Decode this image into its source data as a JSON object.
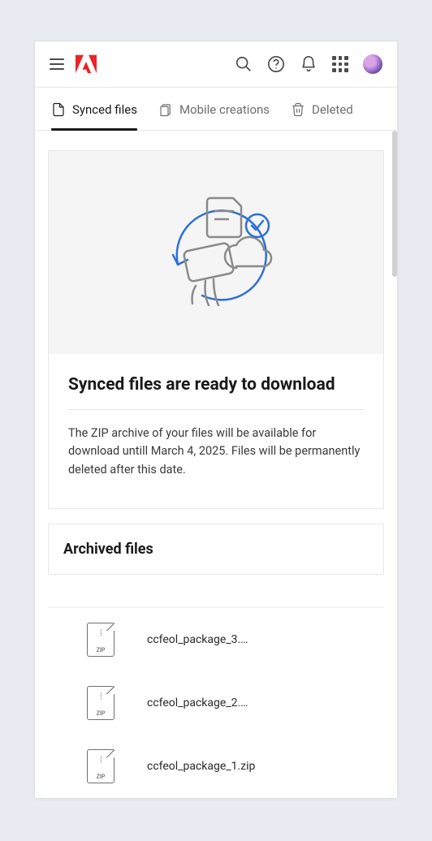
{
  "tabs": [
    {
      "label": "Synced files"
    },
    {
      "label": "Mobile creations"
    },
    {
      "label": "Deleted"
    }
  ],
  "hero": {
    "title": "Synced files are ready to download",
    "body": "The ZIP archive of your files will be available for download untill March 4, 2025. Files will be permanently deleted after this date."
  },
  "archived": {
    "title": "Archived files"
  },
  "files": [
    {
      "name": "ccfeol_package_3.…"
    },
    {
      "name": "ccfeol_package_2.…"
    },
    {
      "name": "ccfeol_package_1.zip"
    }
  ]
}
